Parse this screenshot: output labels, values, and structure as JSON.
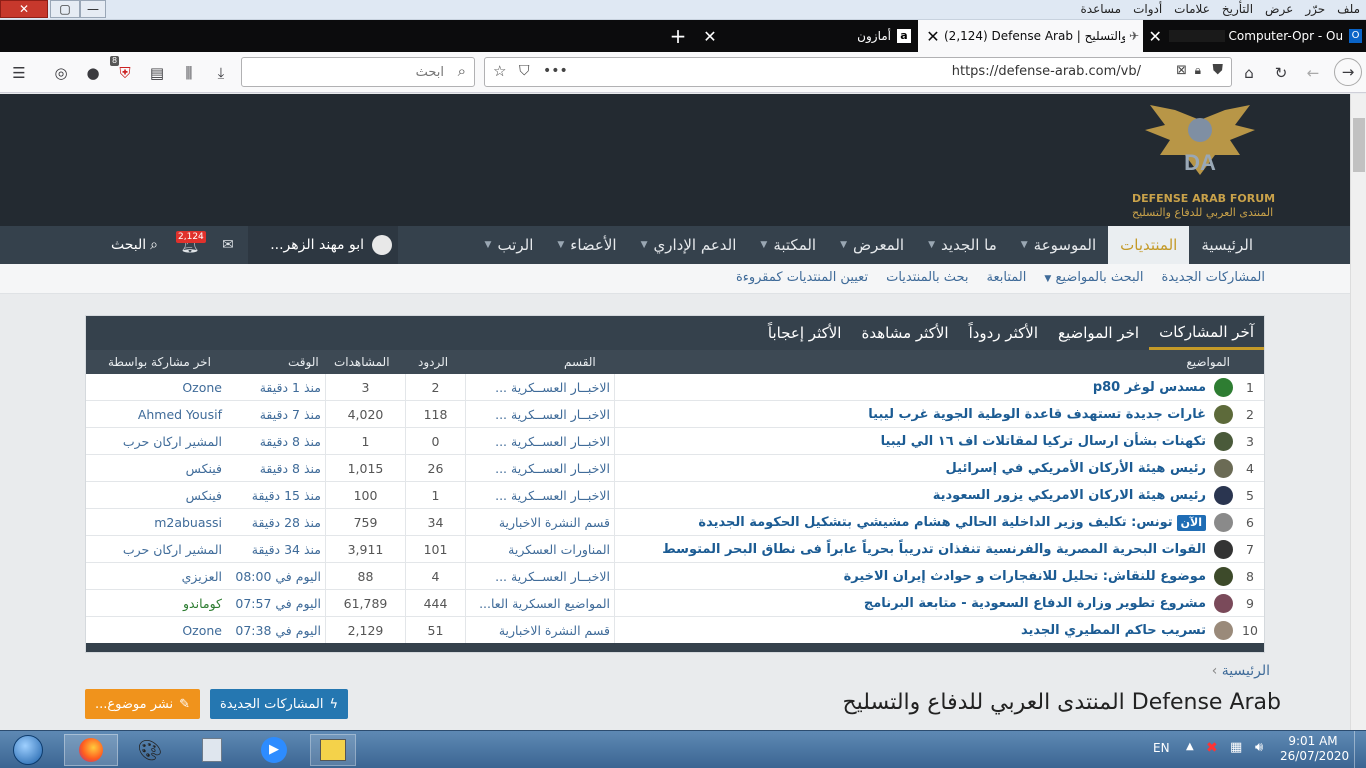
{
  "window": {
    "menu": [
      "ملف",
      "حرّر",
      "عرض",
      "التأريخ",
      "علامات",
      "أدوات",
      "مساعدة"
    ]
  },
  "tabs": [
    {
      "label": "Computer-Opr - Ou"
    },
    {
      "label": "(2,124) Defense Arab | المنتدى العربي للدفاع والتسليح"
    },
    {
      "label": "أمازون"
    }
  ],
  "toolbar": {
    "search_placeholder": "ابحث",
    "url": "https://defense-arab.com/vb/",
    "downloads_badge": "8"
  },
  "site": {
    "logo_line1": "DEFENSE ARAB FORUM",
    "logo_line2": "المنتدى العربي للدفاع والتسليح",
    "nav": [
      {
        "label": "الرئيسية",
        "dropdown": false
      },
      {
        "label": "المنتديات",
        "dropdown": false,
        "active": true
      },
      {
        "label": "الموسوعة",
        "dropdown": true
      },
      {
        "label": "ما الجديد",
        "dropdown": true
      },
      {
        "label": "المعرض",
        "dropdown": true
      },
      {
        "label": "المكتبة",
        "dropdown": true
      },
      {
        "label": "الدعم الإداري",
        "dropdown": true
      },
      {
        "label": "الأعضاء",
        "dropdown": true
      },
      {
        "label": "الرتب",
        "dropdown": true
      }
    ],
    "user_name": "ابو مهند الزهر...",
    "alerts_count": "2,124",
    "search_label": "البحث",
    "subnav": [
      "المشاركات الجديدة",
      "البحث بالمواضيع",
      "المتابعة",
      "بحث بالمنتديات",
      "تعيين المنتديات كمقروءة"
    ]
  },
  "widget": {
    "tabs": [
      "آخر المشاركات",
      "اخر المواضيع",
      "الأكثر ردوداً",
      "الأكثر مشاهدة",
      "الأكثر إعجاباً"
    ],
    "columns": {
      "topics": "المواضيع",
      "section": "القسم",
      "replies": "الردود",
      "views": "المشاهدات",
      "time": "الوقت",
      "last_by": "اخر مشاركة بواسطة"
    },
    "rows": [
      {
        "n": "1",
        "title": "مسدس لوغر p80",
        "section": "الاخبــار العســكرية ...",
        "replies": "2",
        "views": "3",
        "time": "منذ 1 دقيقة",
        "by": "Ozone",
        "avatar": "#2e7d32"
      },
      {
        "n": "2",
        "title": "غارات جديدة تستهدف قاعدة الوطية الجوية غرب ليبيا",
        "section": "الاخبــار العســكرية ...",
        "replies": "118",
        "views": "4,020",
        "time": "منذ 7 دقيقة",
        "by": "Ahmed Yousif",
        "avatar": "#5d6a3a"
      },
      {
        "n": "3",
        "title": "تكهنات بشأن ارسال تركيا لمقاتلات اف ١٦ الي ليبيا",
        "section": "الاخبــار العســكرية ...",
        "replies": "0",
        "views": "1",
        "time": "منذ 8 دقيقة",
        "by": "المشير اركان حرب",
        "avatar": "#4a5a3a"
      },
      {
        "n": "4",
        "title": "رئيس هيئة الأركان الأمريكي في إسرائيل",
        "section": "الاخبــار العســكرية ...",
        "replies": "26",
        "views": "1,015",
        "time": "منذ 8 دقيقة",
        "by": "فينكس",
        "avatar": "#6b6b55"
      },
      {
        "n": "5",
        "title": "رئيس هيئة الاركان الامريكي يزور السعودية",
        "section": "الاخبــار العســكرية ...",
        "replies": "1",
        "views": "100",
        "time": "منذ 15 دقيقة",
        "by": "فينكس",
        "avatar": "#2a3550"
      },
      {
        "n": "6",
        "title": "تونس: تكليف وزير الداخلية الحالي هشام مشيشي بتشكيل الحكومة الجديدة",
        "badge": "الآن",
        "section": "قسم النشرة الاخبارية",
        "replies": "34",
        "views": "759",
        "time": "منذ 28 دقيقة",
        "by": "m2abuassi",
        "avatar": "#8a8a8a"
      },
      {
        "n": "7",
        "title": "القوات البحرية المصرية والفرنسية تنفذان تدريباً بحرياً عابراً فى نطاق البحر المتوسط",
        "section": "المناورات العسكرية",
        "replies": "101",
        "views": "3,911",
        "time": "منذ 34 دقيقة",
        "by": "المشير اركان حرب",
        "avatar": "#333333"
      },
      {
        "n": "8",
        "title": "موضوع للنقاش: تحليل للانفجارات و حوادث إيران الاخيرة",
        "section": "الاخبــار العســكرية ...",
        "replies": "4",
        "views": "88",
        "time": "اليوم في 08:00",
        "by": "العزيزي",
        "avatar": "#3d4a2a"
      },
      {
        "n": "9",
        "title": "مشروع تطوير وزارة الدفاع السعودية - متابعة البرنامج",
        "section": "المواضيع العسكرية العا...",
        "replies": "444",
        "views": "61,789",
        "time": "اليوم في 07:57",
        "by": "كوماندو",
        "by_color": "#2e7d32",
        "avatar": "#7a4a5a"
      },
      {
        "n": "10",
        "title": "تسريب حاكم المطيري الجديد",
        "section": "قسم النشرة الاخبارية",
        "replies": "51",
        "views": "2,129",
        "time": "اليوم في 07:38",
        "by": "Ozone",
        "avatar": "#9a8a7a"
      }
    ]
  },
  "page": {
    "breadcrumb": "الرئيسية",
    "title": "Defense Arab المنتدى العربي للدفاع والتسليح",
    "new_posts_button": "المشاركات الجديدة",
    "post_thread_button": "نشر موضوع..."
  },
  "taskbar": {
    "lang": "EN",
    "time": "9:01 AM",
    "date": "26/07/2020"
  }
}
